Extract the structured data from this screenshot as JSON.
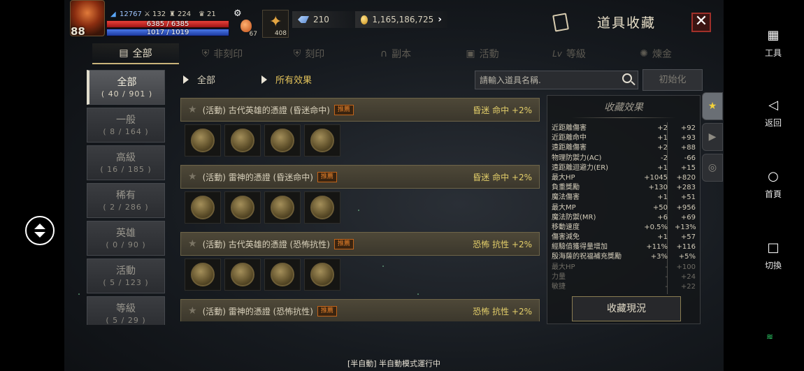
{
  "hud": {
    "level": "88",
    "power": "12767",
    "stat2": "132",
    "stat3": "224",
    "stat4": "21",
    "hp_text": "6385 / 6385",
    "mp_text": "1017 / 1019",
    "hp_fraction": 1.0,
    "mp_fraction": 0.998,
    "potion_count": "67",
    "feather_count": "408",
    "blue_gems": "210",
    "gold": "1,165,186,725"
  },
  "title": "道具收藏",
  "close_label": "✕",
  "tabs": [
    {
      "label": "全部",
      "icon": "book-icon",
      "active": true
    },
    {
      "label": "非刻印",
      "icon": "shield-icon",
      "active": false
    },
    {
      "label": "刻印",
      "icon": "shield-icon",
      "active": false
    },
    {
      "label": "副本",
      "icon": "helmet-icon",
      "active": false
    },
    {
      "label": "活動",
      "icon": "gift-icon",
      "active": false
    },
    {
      "label": "等級",
      "icon": "lv-icon",
      "active": false
    },
    {
      "label": "煉金",
      "icon": "star-icon",
      "active": false
    }
  ],
  "categories": [
    {
      "label": "全部",
      "count": "( 40 / 901 )",
      "active": true
    },
    {
      "label": "一般",
      "count": "( 8 / 164 )",
      "active": false
    },
    {
      "label": "高級",
      "count": "( 16 / 185 )",
      "active": false
    },
    {
      "label": "稀有",
      "count": "( 2 / 286 )",
      "active": false
    },
    {
      "label": "英雄",
      "count": "( 0 / 90 )",
      "active": false
    },
    {
      "label": "活動",
      "count": "( 5 / 123 )",
      "active": false
    },
    {
      "label": "等級",
      "count": "( 5 / 29 )",
      "active": false
    }
  ],
  "filters": {
    "category": "全部",
    "effect": "所有效果"
  },
  "search": {
    "placeholder": "請輸入道具名稱."
  },
  "reset_label": "初始化",
  "entries": [
    {
      "name": "(活動) 古代英雄的憑證 (昏迷命中)",
      "tag": "推薦",
      "effect": "昏迷 命中 +2%",
      "items": 4
    },
    {
      "name": "(活動) 雷神的憑證 (昏迷命中)",
      "tag": "推薦",
      "effect": "昏迷 命中 +2%",
      "items": 4
    },
    {
      "name": "(活動) 古代英雄的憑證 (恐怖抗性)",
      "tag": "推薦",
      "effect": "恐怖 抗性 +2%",
      "items": 4
    },
    {
      "name": "(活動) 雷神的憑證 (恐怖抗性)",
      "tag": "推薦",
      "effect": "恐怖 抗性 +2%",
      "items": 4
    }
  ],
  "effects_panel": {
    "title": "收藏效果",
    "rows": [
      {
        "name": "近距離傷害",
        "a": "+2",
        "b": "+92",
        "dim": false
      },
      {
        "name": "近距離命中",
        "a": "+1",
        "b": "+93",
        "dim": false
      },
      {
        "name": "遠距離傷害",
        "a": "+2",
        "b": "+88",
        "dim": false
      },
      {
        "name": "物理防禦力(AC)",
        "a": "-2",
        "b": "-66",
        "dim": false
      },
      {
        "name": "遠距離迴避力(ER)",
        "a": "+1",
        "b": "+15",
        "dim": false
      },
      {
        "name": "最大HP",
        "a": "+1045",
        "b": "+820",
        "dim": false
      },
      {
        "name": "負重獎勵",
        "a": "+130",
        "b": "+283",
        "dim": false
      },
      {
        "name": "魔法傷害",
        "a": "+1",
        "b": "+51",
        "dim": false
      },
      {
        "name": "最大MP",
        "a": "+50",
        "b": "+956",
        "dim": false
      },
      {
        "name": "魔法防禦(MR)",
        "a": "+6",
        "b": "+69",
        "dim": false
      },
      {
        "name": "移動速度",
        "a": "+0.5%",
        "b": "+13%",
        "dim": false
      },
      {
        "name": "傷害減免",
        "a": "+1",
        "b": "+57",
        "dim": false
      },
      {
        "name": "經驗值獲得量增加",
        "a": "+11%",
        "b": "+116",
        "dim": false
      },
      {
        "name": "殷海薩的祝福補充獎勵",
        "a": "+3%",
        "b": "+5%",
        "dim": false
      },
      {
        "name": "最大HP",
        "a": "-",
        "b": "+100",
        "dim": true
      },
      {
        "name": "力量",
        "a": "-",
        "b": "+24",
        "dim": true
      },
      {
        "name": "敏捷",
        "a": "-",
        "b": "+22",
        "dim": true
      }
    ],
    "status_button": "收藏現況"
  },
  "bottom_message": "[半自動] 半自動模式運行中",
  "system_bar": {
    "tools": "工具",
    "back": "返回",
    "home": "首頁",
    "switch": "切換"
  }
}
